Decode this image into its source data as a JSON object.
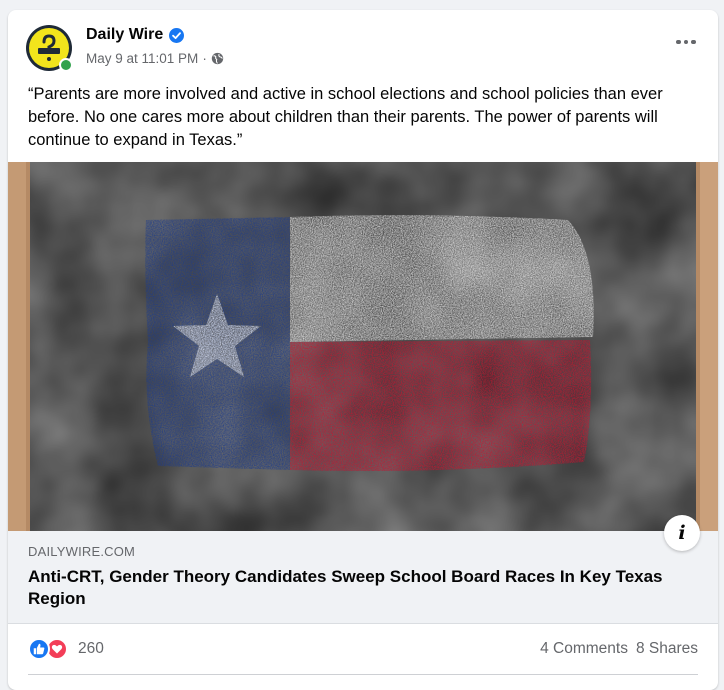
{
  "post": {
    "page_name": "Daily Wire",
    "timestamp": "May 9 at 11:01 PM",
    "separator": "·",
    "audience_icon": "globe-icon",
    "verified_icon": "verified-badge-icon",
    "more_icon": "more-options-icon",
    "text": "“Parents are more involved and active in school elections and school policies than ever before. No one cares more about children than their parents. The power of parents will continue to expand in Texas.”"
  },
  "link_preview": {
    "domain": "DAILYWIRE.COM",
    "title": "Anti-CRT, Gender Theory Candidates Sweep School Board Races In Key Texas Region",
    "info_icon": "info-icon",
    "info_label": "i"
  },
  "engagement": {
    "reaction_icons": [
      "like-icon",
      "love-icon"
    ],
    "reaction_count": "260",
    "comments": "4 Comments",
    "shares": "8 Shares"
  },
  "colors": {
    "brand_blue": "#1877f2",
    "love_red": "#f33e58",
    "online_green": "#31a24c",
    "secondary_text": "#65676b"
  }
}
